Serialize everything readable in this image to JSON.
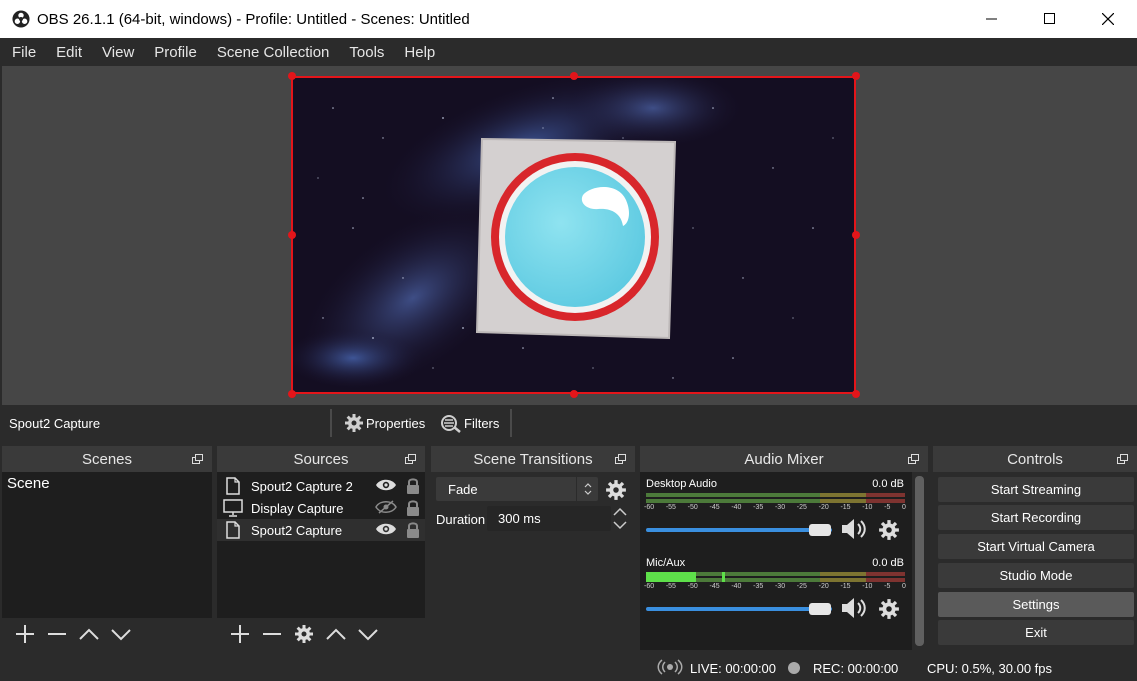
{
  "window": {
    "title": "OBS 26.1.1 (64-bit, windows) - Profile: Untitled - Scenes: Untitled"
  },
  "menu": [
    "File",
    "Edit",
    "View",
    "Profile",
    "Scene Collection",
    "Tools",
    "Help"
  ],
  "source_toolbar": {
    "selected_source": "Spout2 Capture",
    "properties_label": "Properties",
    "filters_label": "Filters"
  },
  "scenes": {
    "title": "Scenes",
    "items": [
      "Scene"
    ]
  },
  "sources": {
    "title": "Sources",
    "items": [
      {
        "name": "Spout2 Capture 2",
        "icon": "file-icon",
        "visible": true,
        "locked": true
      },
      {
        "name": "Display Capture",
        "icon": "monitor-icon",
        "visible": false,
        "locked": true
      },
      {
        "name": "Spout2 Capture",
        "icon": "file-icon",
        "visible": true,
        "locked": true
      }
    ]
  },
  "transitions": {
    "title": "Scene Transitions",
    "selected": "Fade",
    "duration_label": "Duration",
    "duration_value": "300 ms"
  },
  "mixer": {
    "title": "Audio Mixer",
    "channels": [
      {
        "name": "Desktop Audio",
        "db": "0.0 dB"
      },
      {
        "name": "Mic/Aux",
        "db": "0.0 dB"
      }
    ],
    "scale": [
      "-60",
      "-55",
      "-50",
      "-45",
      "-40",
      "-35",
      "-30",
      "-25",
      "-20",
      "-15",
      "-10",
      "-5",
      "0"
    ]
  },
  "controls": {
    "title": "Controls",
    "buttons": [
      "Start Streaming",
      "Start Recording",
      "Start Virtual Camera",
      "Studio Mode",
      "Settings",
      "Exit"
    ]
  },
  "status": {
    "live": "LIVE: 00:00:00",
    "rec": "REC: 00:00:00",
    "cpu": "CPU: 0.5%, 30.00 fps"
  },
  "colors": {
    "selection_red": "#e3151a",
    "slider_blue": "#3a8fdf",
    "logo_cyan": "#6fd3e6",
    "logo_ring": "#d8262b"
  }
}
